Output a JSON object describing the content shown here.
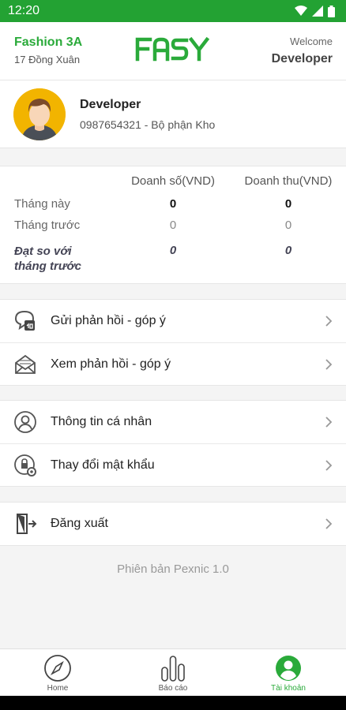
{
  "status_bar": {
    "time": "12:20",
    "icons": [
      "wifi-icon",
      "signal-icon",
      "battery-icon"
    ]
  },
  "header": {
    "shop_name": "Fashion 3A",
    "shop_address": "17 Đồng Xuân",
    "logo_text": "FASY",
    "welcome_label": "Welcome",
    "user_name": "Developer"
  },
  "profile": {
    "name": "Developer",
    "subtitle": "0987654321 - Bộ phận Kho"
  },
  "stats": {
    "columns": [
      "Doanh số(VND)",
      "Doanh thu(VND)"
    ],
    "rows": [
      {
        "label": "Tháng này",
        "sales": "0",
        "revenue": "0"
      },
      {
        "label": "Tháng trước",
        "sales": "0",
        "revenue": "0"
      },
      {
        "label": "Đạt so với tháng trước",
        "label_line1": "Đạt so với",
        "label_line2": "tháng trước",
        "sales": "0",
        "revenue": "0"
      }
    ]
  },
  "menu": {
    "send_feedback": "Gửi phản hồi - góp ý",
    "view_feedback": "Xem phản hồi - góp ý",
    "personal_info": "Thông tin cá nhân",
    "change_password": "Thay đổi mật khẩu",
    "logout": "Đăng xuất"
  },
  "version": "Phiên bản Pexnic 1.0",
  "bottom_nav": [
    {
      "label": "Home",
      "icon": "compass-icon",
      "active": false
    },
    {
      "label": "Báo cáo",
      "icon": "bar-chart-icon",
      "active": false
    },
    {
      "label": "Tài khoản",
      "icon": "account-icon",
      "active": true
    }
  ],
  "colors": {
    "brand_green": "#2aaa3a",
    "status_bar": "#23a233"
  }
}
